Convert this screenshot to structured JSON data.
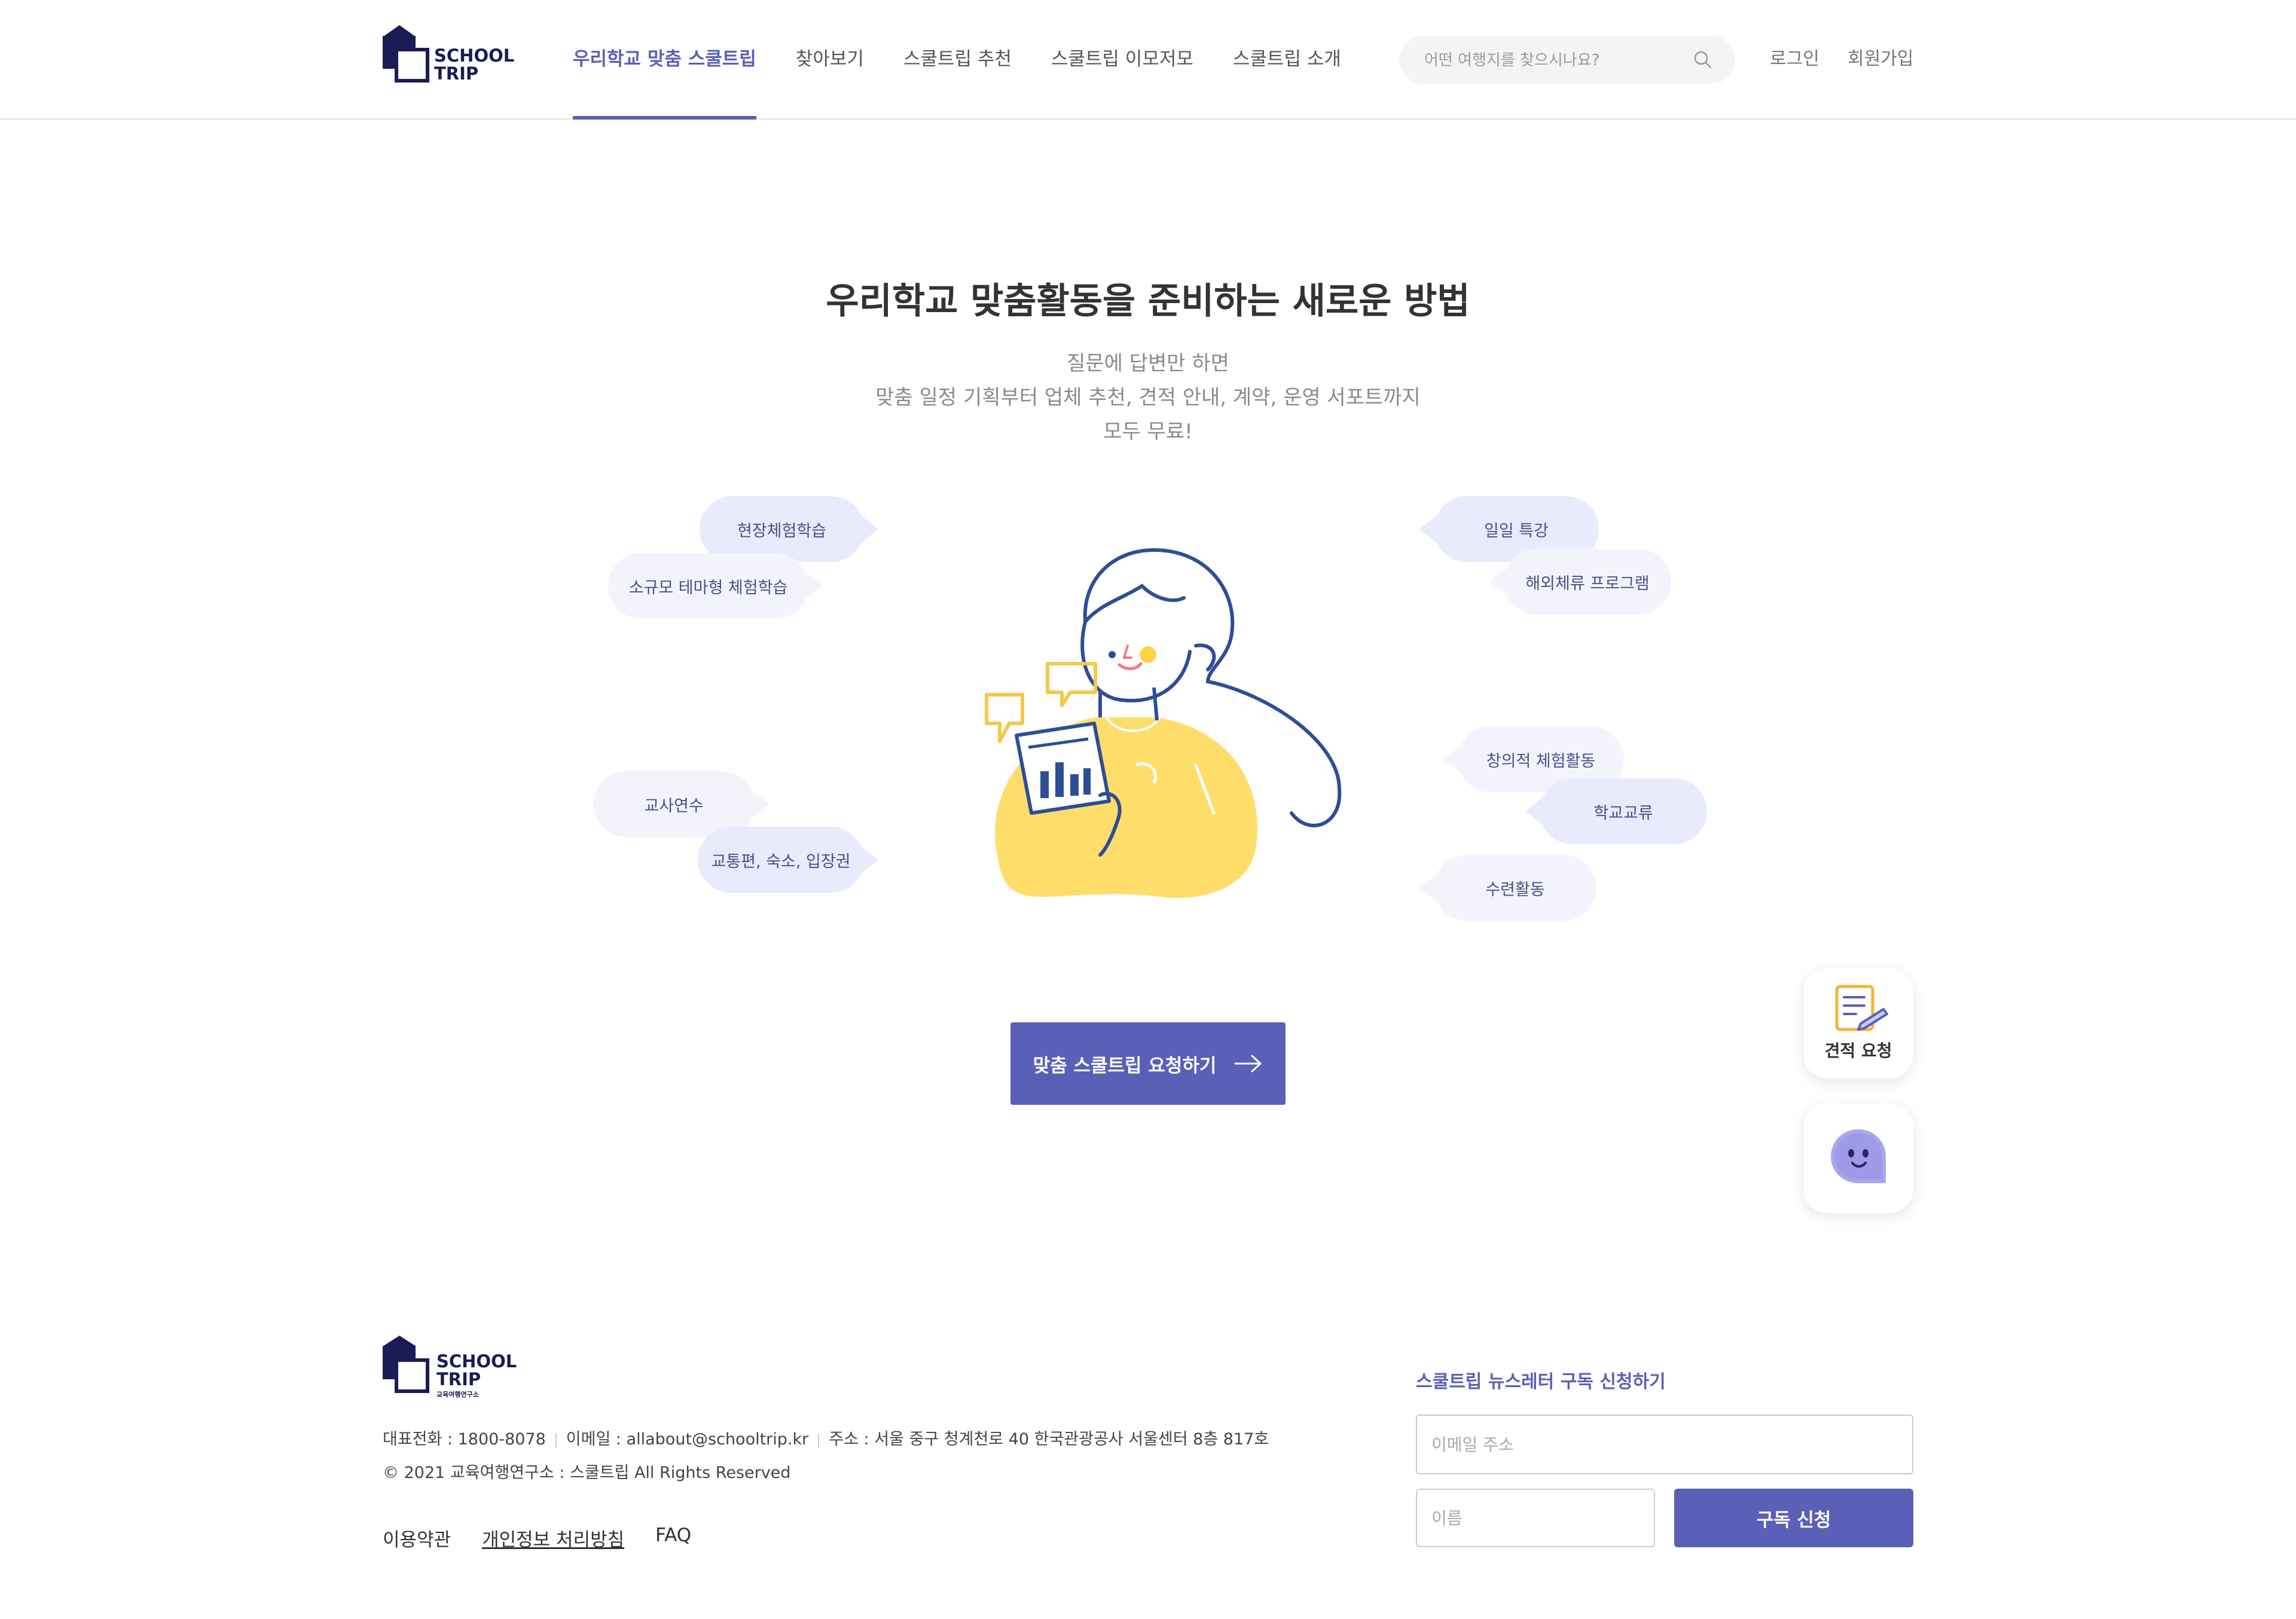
{
  "header": {
    "logo": "SCHOOL TRIP",
    "nav": [
      {
        "label": "우리학교 맞춤 스쿨트립",
        "active": true
      },
      {
        "label": "찾아보기"
      },
      {
        "label": "스쿨트립 추천"
      },
      {
        "label": "스쿨트립 이모저모"
      },
      {
        "label": "스쿨트립 소개"
      }
    ],
    "search_placeholder": "어떤 여행지를 찾으시나요?",
    "login": "로그인",
    "signup": "회원가입"
  },
  "hero": {
    "title": "우리학교 맞춤활동을 준비하는 새로운 방법",
    "sub": [
      "질문에 답변만 하면",
      "맞춤 일정 기획부터 업체 추천, 견적 안내, 계약, 운영 서포트까지",
      "모두 무료!"
    ]
  },
  "bubbles": {
    "left": [
      "현장체험학습",
      "소규모 테마형 체험학습",
      "교사연수",
      "교통편, 숙소, 입장권"
    ],
    "right": [
      "일일 특강",
      "해외체류 프로그램",
      "창의적 체험활동",
      "학교교류",
      "수련활동"
    ]
  },
  "cta": {
    "label": "맞춤 스쿨트립 요청하기"
  },
  "floating": {
    "quote_label": "견적 요청"
  },
  "footer": {
    "logo_sub": "교육여행연구소",
    "phone": "대표전화 : 1800-8078",
    "email": "이메일 : allabout@schooltrip.kr",
    "address": "주소 : 서울 중구 청계천로 40 한국관광공사 서울센터 8층 817호",
    "copyright": "© 2021 교육여행연구소 : 스쿨트립 All Rights Reserved",
    "links": [
      "이용약관",
      "개인정보 처리방침",
      "FAQ"
    ],
    "newsletter_title": "스쿨트립 뉴스레터 구독 신청하기",
    "email_placeholder": "이메일 주소",
    "name_placeholder": "이름",
    "subscribe_label": "구독 신청"
  },
  "colors": {
    "accent": "#5a5fb8",
    "navy": "#1b1b55",
    "bubble": "#e9eafc",
    "yellow": "#ffdd6b"
  }
}
